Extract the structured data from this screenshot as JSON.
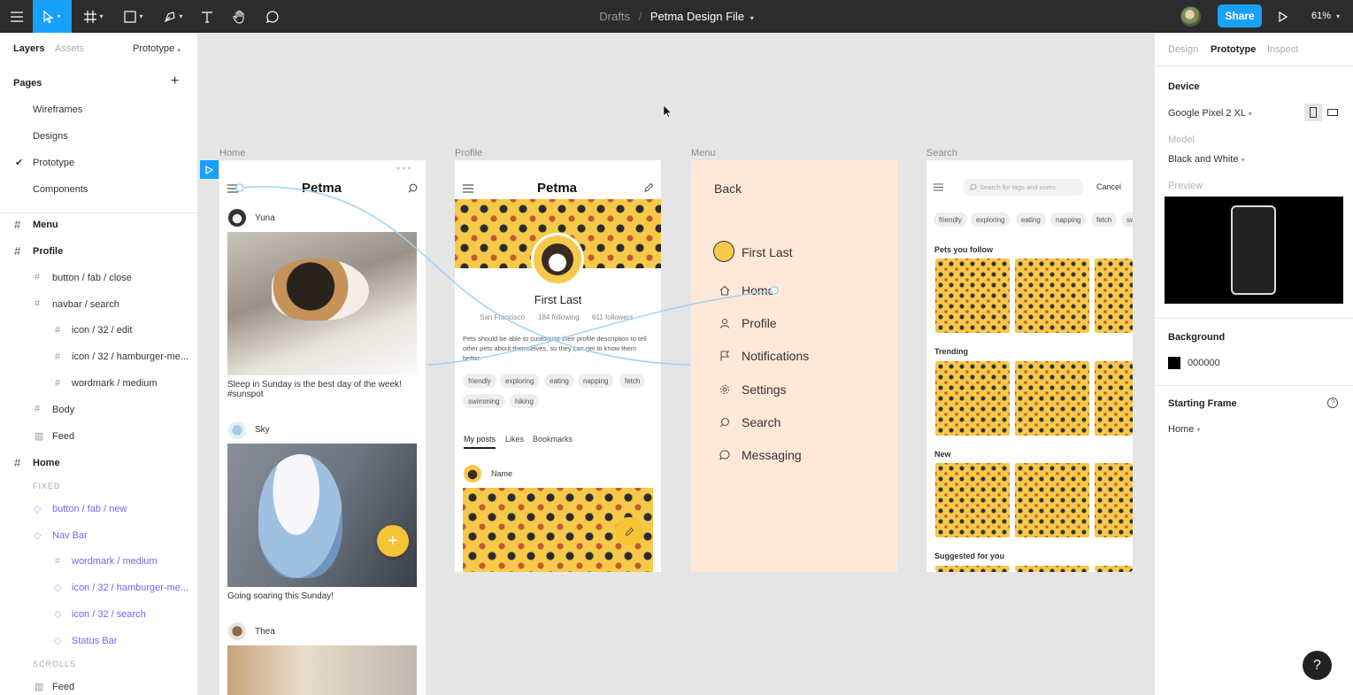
{
  "toolbar": {
    "breadcrumb_root": "Drafts",
    "file_name": "Petma Design File",
    "share_label": "Share",
    "zoom": "61%"
  },
  "left_panel": {
    "tabs": [
      "Layers",
      "Assets"
    ],
    "mode": "Prototype",
    "pages_heading": "Pages",
    "pages": [
      "Wireframes",
      "Designs",
      "Prototype",
      "Components"
    ],
    "current_page": "Prototype",
    "layers": [
      {
        "label": "Menu",
        "icon": "frame-hash-icon",
        "style": "frame"
      },
      {
        "label": "Profile",
        "icon": "frame-hash-icon",
        "style": "frame"
      },
      {
        "label": "button / fab / close",
        "icon": "frame-hash-icon",
        "style": "child"
      },
      {
        "label": "navbar / search",
        "icon": "frame-hash-icon",
        "style": "child"
      },
      {
        "label": "icon / 32 / edit",
        "icon": "frame-hash-icon",
        "style": "grandchild"
      },
      {
        "label": "icon / 32 / hamburger-me...",
        "icon": "frame-hash-icon",
        "style": "grandchild"
      },
      {
        "label": "wordmark / medium",
        "icon": "frame-hash-icon",
        "style": "grandchild"
      },
      {
        "label": "Body",
        "icon": "frame-hash-icon",
        "style": "child"
      },
      {
        "label": "Feed",
        "icon": "columns-icon",
        "style": "child"
      },
      {
        "label": "Home",
        "icon": "frame-hash-icon",
        "style": "frame"
      },
      {
        "label": "button / fab / new",
        "icon": "component-instance-icon",
        "style": "child-purple"
      },
      {
        "label": "Nav Bar",
        "icon": "component-instance-icon",
        "style": "child-purple"
      },
      {
        "label": "wordmark / medium",
        "icon": "frame-hash-icon",
        "style": "grandchild-purple"
      },
      {
        "label": "icon / 32 / hamburger-me...",
        "icon": "component-instance-icon",
        "style": "grandchild-purple"
      },
      {
        "label": "icon / 32 / search",
        "icon": "component-instance-icon",
        "style": "grandchild-purple"
      },
      {
        "label": "Status Bar",
        "icon": "component-instance-icon",
        "style": "grandchild-purple"
      },
      {
        "label": "Feed",
        "icon": "columns-icon",
        "style": "child"
      }
    ],
    "section_fixed": "FIXED",
    "section_scrolls": "SCROLLS"
  },
  "right_panel": {
    "tabs": [
      "Design",
      "Prototype",
      "Inspect"
    ],
    "active_tab": "Prototype",
    "device_heading": "Device",
    "device": "Google Pixel 2 XL",
    "model_label": "Model",
    "model": "Black and White",
    "preview_label": "Preview",
    "background_heading": "Background",
    "background_color": "000000",
    "starting_frame_heading": "Starting Frame",
    "starting_frame": "Home"
  },
  "canvas": {
    "frame_labels": [
      "Home",
      "Profile",
      "Menu",
      "Search"
    ],
    "home": {
      "wordmark": "Petma",
      "posts": [
        {
          "user": "Yuna",
          "caption": "Sleep in Sunday is the best day of the week! #sunspot"
        },
        {
          "user": "Sky",
          "caption": "Going soaring this Sunday!"
        },
        {
          "user": "Thea",
          "caption": ""
        }
      ]
    },
    "profile": {
      "wordmark": "Petma",
      "name": "First Last",
      "location": "San Francisco",
      "following": "184 following",
      "followers": "611 followers",
      "bio": "Pets should be able to customize their profile description to tell other pets about themselves, so they can get to know them better.",
      "tags": [
        "friendly",
        "exploring",
        "eating",
        "napping",
        "fetch",
        "swimming",
        "hiking"
      ],
      "tabs": [
        "My posts",
        "Likes",
        "Bookmarks"
      ],
      "post_name": "Name"
    },
    "menu": {
      "back": "Back",
      "name": "First Last",
      "items": [
        {
          "label": "Home",
          "icon": "home-icon"
        },
        {
          "label": "Profile",
          "icon": "user-icon"
        },
        {
          "label": "Notifications",
          "icon": "flag-icon"
        },
        {
          "label": "Settings",
          "icon": "gear-icon"
        },
        {
          "label": "Search",
          "icon": "search-icon"
        },
        {
          "label": "Messaging",
          "icon": "chat-icon"
        }
      ]
    },
    "search": {
      "placeholder": "Search for tags and users",
      "cancel": "Cancel",
      "tags": [
        "friendly",
        "exploring",
        "eating",
        "napping",
        "fetch",
        "sw"
      ],
      "sections": [
        "Pets you follow",
        "Trending",
        "New",
        "Suggested for you"
      ]
    }
  },
  "colors": {
    "toolbar_bg": "#2c2c2c",
    "accent": "#18a0fb",
    "menu_bg": "#ffe8d8",
    "brand_yellow": "#f6c94b",
    "component_purple": "#7b61ff"
  }
}
